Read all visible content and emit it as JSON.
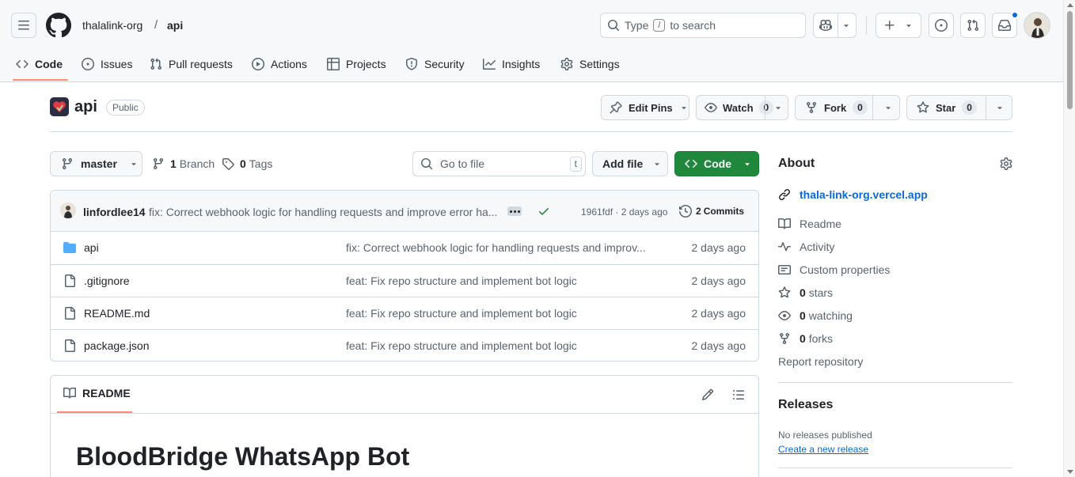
{
  "header": {
    "owner": "thalalink-org",
    "separator": "/",
    "repo": "api",
    "search_prefix": "Type",
    "search_key": "/",
    "search_suffix": "to search"
  },
  "tabs": [
    {
      "label": "Code",
      "icon": "code-icon",
      "selected": true
    },
    {
      "label": "Issues",
      "icon": "issue-opened-icon"
    },
    {
      "label": "Pull requests",
      "icon": "git-pull-request-icon"
    },
    {
      "label": "Actions",
      "icon": "play-icon"
    },
    {
      "label": "Projects",
      "icon": "table-icon"
    },
    {
      "label": "Security",
      "icon": "shield-icon"
    },
    {
      "label": "Insights",
      "icon": "graph-icon"
    },
    {
      "label": "Settings",
      "icon": "gear-icon"
    }
  ],
  "repo_header": {
    "name": "api",
    "visibility": "Public",
    "edit_pins": "Edit Pins",
    "watch": "Watch",
    "watch_count": "0",
    "fork": "Fork",
    "fork_count": "0",
    "star": "Star",
    "star_count": "0"
  },
  "toolbar": {
    "branch": "master",
    "branch_count": "1",
    "branch_label": "Branch",
    "tag_count": "0",
    "tag_label": "Tags",
    "goto_placeholder": "Go to file",
    "goto_key": "t",
    "add_file": "Add file",
    "code": "Code"
  },
  "commit": {
    "author": "linfordlee14",
    "message": "fix: Correct webhook logic for handling requests and improve error ha...",
    "meta": "1961fdf · 2 days ago",
    "commits_count": "2",
    "commits_label": "Commits"
  },
  "files": [
    {
      "name": "api",
      "type": "folder",
      "message": "fix: Correct webhook logic for handling requests and improv...",
      "date": "2 days ago"
    },
    {
      "name": ".gitignore",
      "type": "file",
      "message": "feat: Fix repo structure and implement bot logic",
      "date": "2 days ago"
    },
    {
      "name": "README.md",
      "type": "file",
      "message": "feat: Fix repo structure and implement bot logic",
      "date": "2 days ago"
    },
    {
      "name": "package.json",
      "type": "file",
      "message": "feat: Fix repo structure and implement bot logic",
      "date": "2 days ago"
    }
  ],
  "readme": {
    "tab_label": "README",
    "heading": "BloodBridge WhatsApp Bot"
  },
  "about": {
    "title": "About",
    "link": "thala-link-org.vercel.app",
    "readme": "Readme",
    "activity": "Activity",
    "custom_properties": "Custom properties",
    "stars_count": "0",
    "stars_label": "stars",
    "watching_count": "0",
    "watching_label": "watching",
    "forks_count": "0",
    "forks_label": "forks",
    "report": "Report repository"
  },
  "releases": {
    "title": "Releases",
    "none_text": "No releases published",
    "create_link": "Create a new release"
  },
  "colors": {
    "accent_link": "#0969da",
    "code_button": "#1f883d",
    "tab_underline": "#fd8c73"
  }
}
